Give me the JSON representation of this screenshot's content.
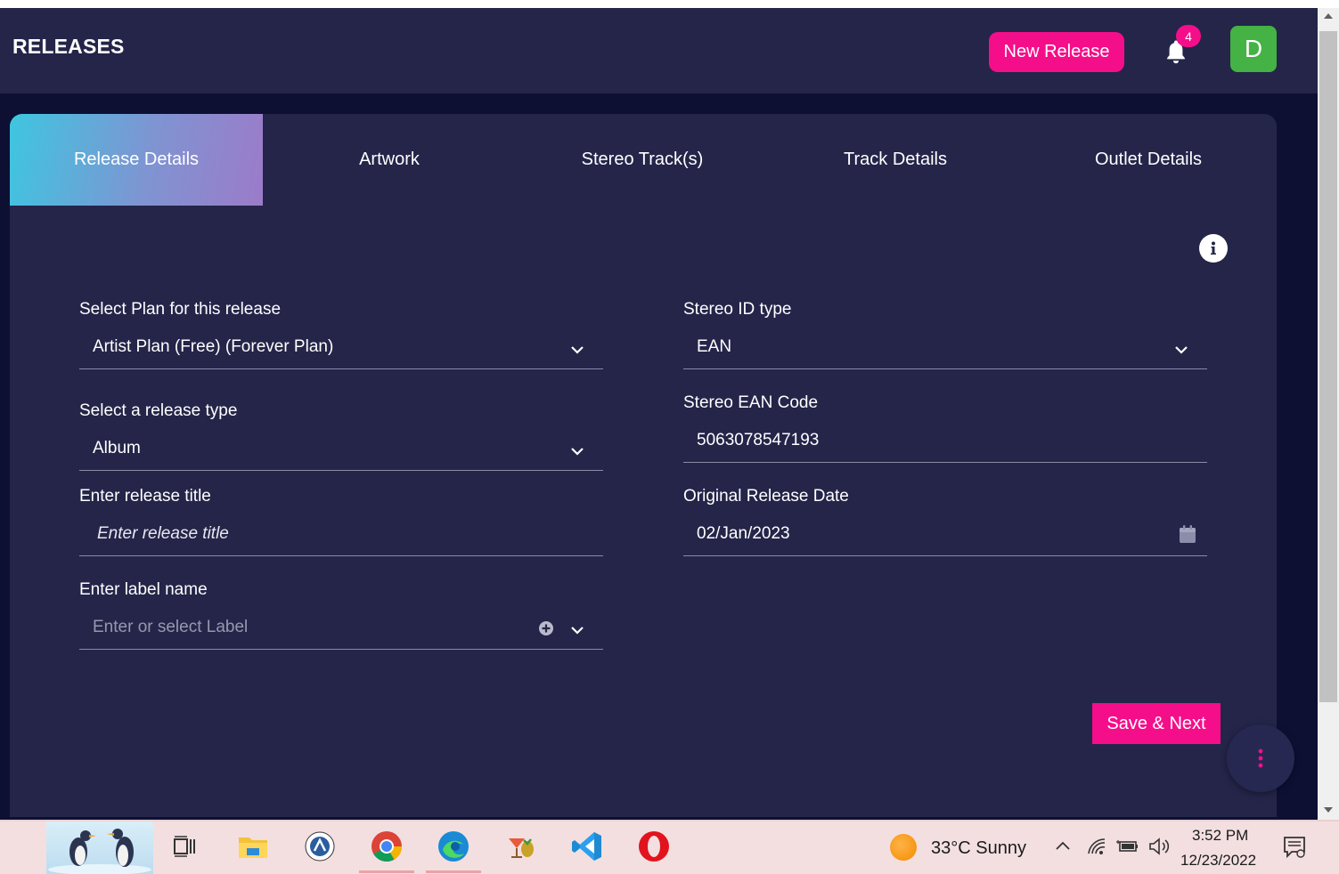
{
  "header": {
    "title": "RELEASES",
    "new_release_label": "New Release",
    "notification_count": "4",
    "avatar_initial": "D"
  },
  "tabs": [
    {
      "label": "Release Details",
      "active": true
    },
    {
      "label": "Artwork",
      "active": false
    },
    {
      "label": "Stereo Track(s)",
      "active": false
    },
    {
      "label": "Track Details",
      "active": false
    },
    {
      "label": "Outlet Details",
      "active": false
    }
  ],
  "form": {
    "plan": {
      "label": "Select Plan for this release",
      "value": "Artist Plan (Free) (Forever Plan)"
    },
    "release_type": {
      "label": "Select a release type",
      "value": "Album"
    },
    "release_title": {
      "label": "Enter release title",
      "placeholder": "Enter release title"
    },
    "label_name": {
      "label": "Enter label name",
      "placeholder": "Enter or select Label"
    },
    "stereo_id_type": {
      "label": "Stereo ID type",
      "value": "EAN"
    },
    "stereo_ean_code": {
      "label": "Stereo EAN Code",
      "value": "5063078547193"
    },
    "original_release_date": {
      "label": "Original Release Date",
      "value": "02/Jan/2023"
    }
  },
  "actions": {
    "save_next_label": "Save & Next"
  },
  "taskbar": {
    "weather_temp": "33°C",
    "weather_condition": "Sunny",
    "time": "3:52 PM",
    "date": "12/23/2022"
  },
  "colors": {
    "accent": "#f50e8a",
    "header_bg": "#242549",
    "page_bg": "#0d1033",
    "avatar_bg": "#44b244"
  }
}
